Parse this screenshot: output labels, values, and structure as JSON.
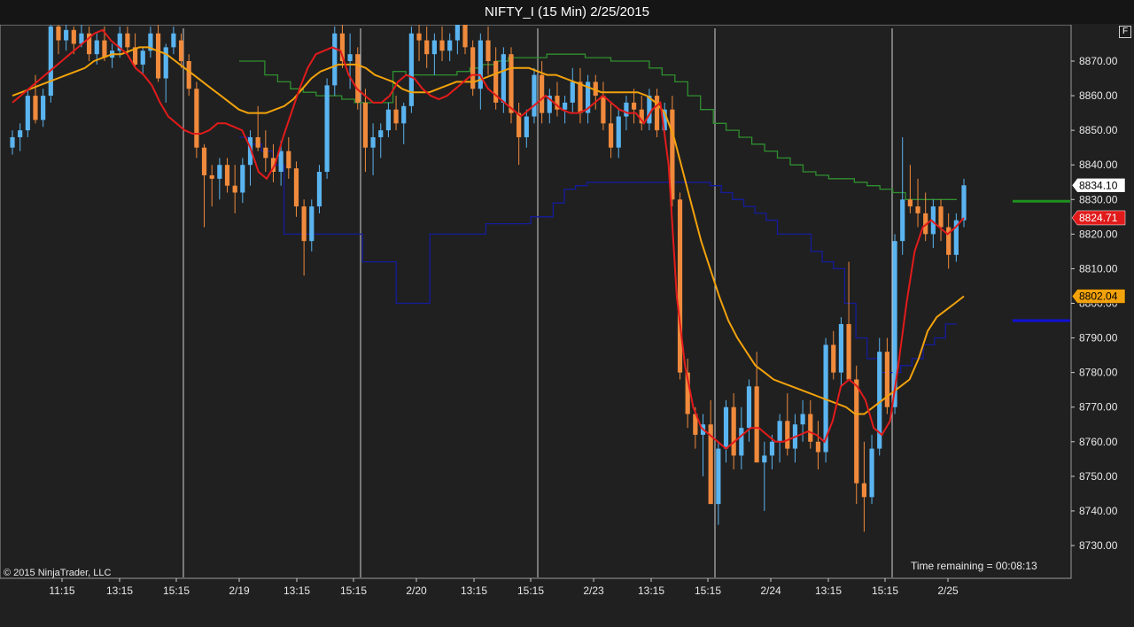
{
  "window": {
    "title": "NIFTY_I (15 Min)  2/25/2015"
  },
  "chart_toolbar": {
    "f_button_label": "F"
  },
  "copyright": "© 2015 NinjaTrader, LLC",
  "time_remaining": "Time remaining = 00:08:13",
  "colors": {
    "background": "#202020",
    "up_candle": "#5ab4f0",
    "down_candle": "#f08a3c",
    "fast_ma": "#e11b1b",
    "slow_ma": "#f2a20c",
    "green_stair": "#2f8f2f",
    "blue_stair": "#141c9c",
    "profile_fill": "#1e6f8f",
    "profile_edge": "#e52020",
    "axis_text": "#e8e8e8",
    "grid_vertical": "#cfcfcf"
  },
  "chart_data": {
    "type": "candlestick",
    "title": "NIFTY_I (15 Min)  2/25/2015",
    "ylim": [
      8724,
      8876
    ],
    "y_ticks": [
      8730,
      8740,
      8750,
      8760,
      8770,
      8780,
      8790,
      8800,
      8810,
      8820,
      8830,
      8840,
      8850,
      8860,
      8870
    ],
    "x_tick_labels": [
      "11:15",
      "13:15",
      "15:15",
      "2/19",
      "13:15",
      "15:15",
      "2/20",
      "13:15",
      "15:15",
      "2/23",
      "13:15",
      "15:15",
      "2/24",
      "13:15",
      "15:15",
      "2/25"
    ],
    "session_separators_after_label": [
      "15:15",
      "15:15",
      "15:15",
      "15:15",
      "15:15"
    ],
    "price_markers": [
      {
        "value": 8834.1,
        "label": "8834.10",
        "style": "last"
      },
      {
        "value": 8824.71,
        "label": "8824.71",
        "style": "fast_ma"
      },
      {
        "value": 8802.04,
        "label": "8802.04",
        "style": "slow_ma"
      }
    ],
    "horizontal_markers": [
      {
        "value": 8829.5,
        "color": "green"
      },
      {
        "value": 8795,
        "color": "blue"
      }
    ],
    "candles": [
      [
        8845,
        8850,
        8843,
        8848
      ],
      [
        8848,
        8852,
        8844,
        8850
      ],
      [
        8850,
        8862,
        8848,
        8860
      ],
      [
        8860,
        8866,
        8852,
        8853
      ],
      [
        8853,
        8862,
        8851,
        8860
      ],
      [
        8860,
        8882,
        8858,
        8880
      ],
      [
        8880,
        8884,
        8872,
        8876
      ],
      [
        8876,
        8882,
        8873,
        8879
      ],
      [
        8879,
        8880,
        8872,
        8875
      ],
      [
        8875,
        8882,
        8874,
        8878
      ],
      [
        8878,
        8880,
        8870,
        8872
      ],
      [
        8872,
        8878,
        8869,
        8876
      ],
      [
        8876,
        8880,
        8870,
        8871
      ],
      [
        8871,
        8875,
        8868,
        8873
      ],
      [
        8873,
        8880,
        8871,
        8878
      ],
      [
        8878,
        8880,
        8872,
        8874
      ],
      [
        8874,
        8878,
        8868,
        8869
      ],
      [
        8869,
        8874,
        8866,
        8873
      ],
      [
        8873,
        8880,
        8871,
        8878
      ],
      [
        8878,
        8882,
        8864,
        8865
      ],
      [
        8865,
        8875,
        8858,
        8874
      ],
      [
        8874,
        8880,
        8872,
        8878
      ],
      [
        8876,
        8878,
        8868,
        8870
      ],
      [
        8870,
        8872,
        8860,
        8862
      ],
      [
        8862,
        8864,
        8842,
        8845
      ],
      [
        8845,
        8846,
        8822,
        8837
      ],
      [
        8837,
        8840,
        8828,
        8836
      ],
      [
        8836,
        8842,
        8830,
        8840
      ],
      [
        8840,
        8842,
        8832,
        8834
      ],
      [
        8834,
        8840,
        8826,
        8832
      ],
      [
        8832,
        8842,
        8829,
        8840
      ],
      [
        8840,
        8850,
        8834,
        8848
      ],
      [
        8848,
        8857,
        8844,
        8845
      ],
      [
        8845,
        8850,
        8838,
        8842
      ],
      [
        8842,
        8846,
        8835,
        8838
      ],
      [
        8838,
        8847,
        8834,
        8844
      ],
      [
        8844,
        8848,
        8836,
        8839
      ],
      [
        8839,
        8841,
        8825,
        8828
      ],
      [
        8828,
        8830,
        8808,
        8818
      ],
      [
        8818,
        8830,
        8815,
        8828
      ],
      [
        8828,
        8840,
        8826,
        8838
      ],
      [
        8838,
        8865,
        8836,
        8863
      ],
      [
        8863,
        8880,
        8860,
        8878
      ],
      [
        8878,
        8884,
        8868,
        8870
      ],
      [
        8870,
        8878,
        8862,
        8872
      ],
      [
        8872,
        8874,
        8856,
        8858
      ],
      [
        8858,
        8862,
        8838,
        8845
      ],
      [
        8845,
        8852,
        8837,
        8848
      ],
      [
        8848,
        8852,
        8842,
        8850
      ],
      [
        8850,
        8858,
        8848,
        8856
      ],
      [
        8856,
        8860,
        8850,
        8852
      ],
      [
        8852,
        8858,
        8846,
        8857
      ],
      [
        8857,
        8880,
        8855,
        8878
      ],
      [
        8878,
        8882,
        8870,
        8876
      ],
      [
        8876,
        8880,
        8868,
        8872
      ],
      [
        8872,
        8878,
        8866,
        8876
      ],
      [
        8876,
        8880,
        8870,
        8873
      ],
      [
        8873,
        8878,
        8870,
        8876
      ],
      [
        8876,
        8884,
        8872,
        8882
      ],
      [
        8882,
        8884,
        8872,
        8874
      ],
      [
        8874,
        8876,
        8860,
        8862
      ],
      [
        8862,
        8878,
        8856,
        8876
      ],
      [
        8876,
        8880,
        8866,
        8870
      ],
      [
        8870,
        8874,
        8856,
        8858
      ],
      [
        8858,
        8874,
        8855,
        8872
      ],
      [
        8872,
        8874,
        8852,
        8855
      ],
      [
        8855,
        8858,
        8840,
        8848
      ],
      [
        8848,
        8856,
        8845,
        8854
      ],
      [
        8854,
        8868,
        8852,
        8866
      ],
      [
        8866,
        8870,
        8852,
        8855
      ],
      [
        8855,
        8862,
        8852,
        8860
      ],
      [
        8860,
        8864,
        8854,
        8856
      ],
      [
        8856,
        8860,
        8852,
        8858
      ],
      [
        8858,
        8868,
        8855,
        8864
      ],
      [
        8864,
        8868,
        8852,
        8855
      ],
      [
        8855,
        8866,
        8852,
        8864
      ],
      [
        8864,
        8866,
        8856,
        8860
      ],
      [
        8860,
        8864,
        8850,
        8852
      ],
      [
        8852,
        8858,
        8842,
        8845
      ],
      [
        8845,
        8856,
        8842,
        8854
      ],
      [
        8854,
        8860,
        8850,
        8858
      ],
      [
        8858,
        8862,
        8852,
        8856
      ],
      [
        8856,
        8860,
        8850,
        8852
      ],
      [
        8852,
        8862,
        8850,
        8860
      ],
      [
        8860,
        8862,
        8848,
        8850
      ],
      [
        8850,
        8858,
        8848,
        8856
      ],
      [
        8856,
        8860,
        8828,
        8830
      ],
      [
        8830,
        8832,
        8778,
        8780
      ],
      [
        8780,
        8784,
        8764,
        8768
      ],
      [
        8768,
        8770,
        8758,
        8762
      ],
      [
        8762,
        8768,
        8750,
        8765
      ],
      [
        8765,
        8772,
        8748,
        8742
      ],
      [
        8742,
        8760,
        8736,
        8758
      ],
      [
        8758,
        8772,
        8754,
        8770
      ],
      [
        8770,
        8774,
        8752,
        8756
      ],
      [
        8756,
        8770,
        8752,
        8764
      ],
      [
        8764,
        8778,
        8760,
        8776
      ],
      [
        8776,
        8786,
        8772,
        8754
      ],
      [
        8754,
        8760,
        8740,
        8756
      ],
      [
        8756,
        8762,
        8752,
        8760
      ],
      [
        8760,
        8768,
        8754,
        8766
      ],
      [
        8766,
        8774,
        8756,
        8758
      ],
      [
        8758,
        8768,
        8754,
        8765
      ],
      [
        8765,
        8772,
        8760,
        8768
      ],
      [
        8768,
        8772,
        8758,
        8760
      ],
      [
        8760,
        8766,
        8752,
        8757
      ],
      [
        8757,
        8790,
        8754,
        8788
      ],
      [
        8788,
        8792,
        8778,
        8780
      ],
      [
        8780,
        8796,
        8776,
        8794
      ],
      [
        8794,
        8812,
        8786,
        8778
      ],
      [
        8778,
        8782,
        8742,
        8748
      ],
      [
        8748,
        8760,
        8734,
        8744
      ],
      [
        8744,
        8762,
        8742,
        8758
      ],
      [
        8758,
        8790,
        8756,
        8786
      ],
      [
        8786,
        8790,
        8768,
        8770
      ],
      [
        8770,
        8820,
        8768,
        8818
      ],
      [
        8818,
        8848,
        8814,
        8830
      ],
      [
        8830,
        8840,
        8826,
        8828
      ],
      [
        8828,
        8836,
        8822,
        8826
      ],
      [
        8826,
        8832,
        8818,
        8820
      ],
      [
        8820,
        8830,
        8816,
        8828
      ],
      [
        8828,
        8830,
        8818,
        8822
      ],
      [
        8822,
        8826,
        8810,
        8814
      ],
      [
        8814,
        8826,
        8812,
        8824
      ],
      [
        8824,
        8836,
        8822,
        8834.1
      ]
    ],
    "fast_ma": [
      8858,
      8860,
      8862,
      8864,
      8866,
      8868,
      8870,
      8872,
      8874,
      8876,
      8878,
      8879,
      8876,
      8874,
      8872,
      8868,
      8866,
      8863,
      8858,
      8854,
      8852,
      8850,
      8849,
      8849,
      8850,
      8852,
      8852,
      8851,
      8850,
      8845,
      8838,
      8836,
      8840,
      8848,
      8855,
      8862,
      8868,
      8872,
      8873,
      8874,
      8873,
      8866,
      8862,
      8860,
      8858,
      8858,
      8860,
      8864,
      8866,
      8865,
      8862,
      8860,
      8859,
      8860,
      8862,
      8864,
      8866,
      8866,
      8862,
      8860,
      8858,
      8856,
      8854,
      8856,
      8858,
      8860,
      8858,
      8856,
      8855,
      8855,
      8856,
      8858,
      8860,
      8858,
      8856,
      8855,
      8855,
      8852,
      8856,
      8858,
      8840,
      8802,
      8782,
      8770,
      8764,
      8762,
      8760,
      8758,
      8760,
      8762,
      8764,
      8764,
      8762,
      8760,
      8760,
      8761,
      8762,
      8763,
      8762,
      8760,
      8766,
      8776,
      8778,
      8776,
      8772,
      8764,
      8762,
      8766,
      8782,
      8800,
      8815,
      8822,
      8824,
      8822,
      8820,
      8822,
      8824.71
    ],
    "slow_ma": [
      8860,
      8861,
      8862,
      8863,
      8864,
      8865,
      8866,
      8867,
      8868,
      8870,
      8871,
      8872,
      8872,
      8873,
      8874,
      8874,
      8873,
      8872,
      8870,
      8868,
      8866,
      8864,
      8862,
      8860,
      8858,
      8856,
      8855,
      8855,
      8855,
      8856,
      8857,
      8859,
      8862,
      8865,
      8867,
      8868,
      8869,
      8869,
      8869,
      8868,
      8866,
      8865,
      8864,
      8862,
      8861,
      8861,
      8861,
      8862,
      8863,
      8864,
      8864,
      8864,
      8865,
      8866,
      8867,
      8868,
      8868,
      8868,
      8867,
      8866,
      8866,
      8865,
      8864,
      8863,
      8862,
      8861,
      8861,
      8861,
      8861,
      8861,
      8860,
      8858,
      8855,
      8848,
      8838,
      8828,
      8818,
      8810,
      8802,
      8795,
      8790,
      8786,
      8782,
      8780,
      8778,
      8777,
      8776,
      8775,
      8774,
      8773,
      8772,
      8771,
      8770,
      8768,
      8768,
      8770,
      8772,
      8774,
      8776,
      8778,
      8784,
      8792,
      8796,
      8798,
      8800,
      8802.04
    ],
    "green_stair": [
      8870,
      8870,
      8866,
      8864,
      8862,
      8861,
      8860,
      8860,
      8859,
      8858,
      8858,
      8858,
      8867,
      8866,
      8866,
      8866,
      8866,
      8867,
      8868,
      8869,
      8870,
      8871,
      8871,
      8871,
      8872,
      8872,
      8872,
      8871,
      8871,
      8870,
      8870,
      8870,
      8868,
      8866,
      8864,
      8860,
      8856,
      8852,
      8850,
      8848,
      8846,
      8844,
      8842,
      8840,
      8838,
      8837,
      8836,
      8836,
      8835,
      8834,
      8833,
      8832,
      8830,
      8830,
      8830,
      8830
    ],
    "blue_stair": [
      8848,
      8846,
      8844,
      8840,
      8820,
      8820,
      8820,
      8820,
      8820,
      8820,
      8820,
      8812,
      8812,
      8812,
      8800,
      8800,
      8800,
      8820,
      8820,
      8820,
      8820,
      8820,
      8823,
      8823,
      8823,
      8823,
      8825,
      8825,
      8829,
      8833,
      8834,
      8835,
      8835,
      8835,
      8835,
      8835,
      8835,
      8835,
      8835,
      8835,
      8835,
      8835,
      8834,
      8832,
      8830,
      8828,
      8826,
      8824,
      8820,
      8820,
      8820,
      8815,
      8812,
      8810,
      8800,
      8790,
      8784,
      8780,
      8780,
      8782,
      8784,
      8788,
      8790,
      8794
    ]
  }
}
